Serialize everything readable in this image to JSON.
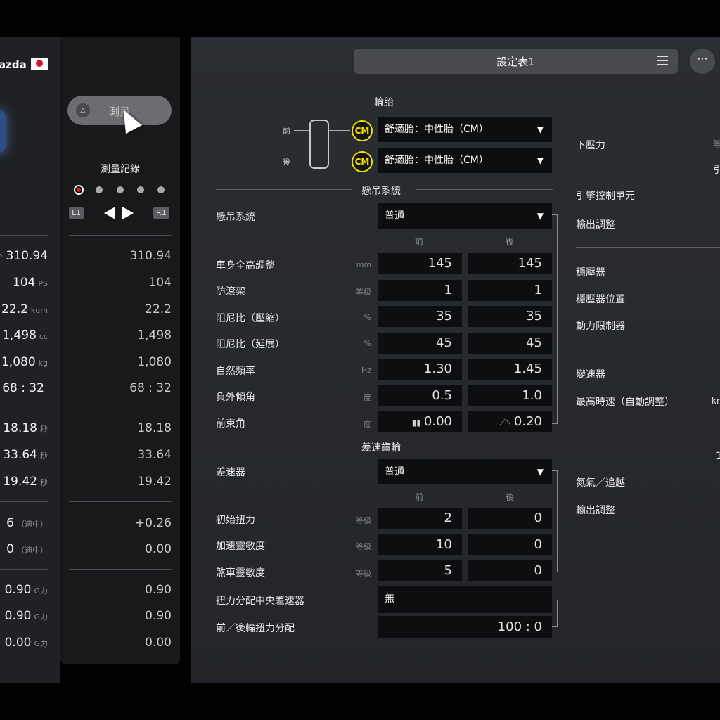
{
  "left_panel": {
    "car_name": "azda",
    "rows": [
      {
        "value": "310.94",
        "unit": "",
        "prefix": "P"
      },
      {
        "value": "104",
        "unit": "PS"
      },
      {
        "value": "22.2",
        "unit": "kgm"
      },
      {
        "value": "1,498",
        "unit": "cc"
      },
      {
        "value": "1,080",
        "unit": "kg"
      },
      {
        "value": "68 : 32",
        "unit": ""
      },
      {
        "value": "18.18",
        "unit": "秒"
      },
      {
        "value": "33.64",
        "unit": "秒"
      },
      {
        "value": "19.42",
        "unit": "秒"
      },
      {
        "value": "6",
        "unit": "（適中）"
      },
      {
        "value": "0",
        "unit": "（適中）"
      },
      {
        "value": "0.90",
        "unit": "G力"
      },
      {
        "value": "0.90",
        "unit": "G力"
      },
      {
        "value": "0.00",
        "unit": "G力"
      }
    ]
  },
  "compare_panel": {
    "measure_label": "測量",
    "measure_icon": "triangle-icon",
    "log_title": "測量紀錄",
    "l1": "L1",
    "r1": "R1",
    "rows": [
      "310.94",
      "104",
      "22.2",
      "1,498",
      "1,080",
      "68 : 32",
      "18.18",
      "33.64",
      "19.42",
      "+0.26",
      "0.00",
      "0.90",
      "0.90",
      "0.00"
    ]
  },
  "header": {
    "sheet_title": "設定表1",
    "more_label": "···"
  },
  "tires": {
    "title": "輪胎",
    "front_label": "前",
    "rear_label": "後",
    "badge": "CM",
    "front_value": "舒適胎：中性胎（CM）",
    "rear_value": "舒適胎：中性胎（CM）"
  },
  "suspension": {
    "title": "懸吊系統",
    "type_label": "懸吊系統",
    "type_value": "普通",
    "front_header": "前",
    "rear_header": "後",
    "rows": [
      {
        "label": "車身全高調整",
        "unit": "mm",
        "front": "145",
        "rear": "145"
      },
      {
        "label": "防滾架",
        "unit": "等級",
        "front": "1",
        "rear": "1"
      },
      {
        "label": "阻尼比（壓縮）",
        "unit": "%",
        "front": "35",
        "rear": "35"
      },
      {
        "label": "阻尼比（延展）",
        "unit": "%",
        "front": "45",
        "rear": "45"
      },
      {
        "label": "自然頻率",
        "unit": "Hz",
        "front": "1.30",
        "rear": "1.45"
      },
      {
        "label": "負外傾角",
        "unit": "度",
        "front": "0.5",
        "rear": "1.0"
      },
      {
        "label": "前束角",
        "unit": "度",
        "front": "0.00",
        "rear": "0.20"
      }
    ]
  },
  "differential": {
    "title": "差速齒輪",
    "type_label": "差速器",
    "type_value": "普通",
    "front_header": "前",
    "rear_header": "後",
    "rows": [
      {
        "label": "初始扭力",
        "unit": "等級",
        "front": "2",
        "rear": "0"
      },
      {
        "label": "加速靈敏度",
        "unit": "等級",
        "front": "10",
        "rear": "0"
      },
      {
        "label": "煞車靈敏度",
        "unit": "等級",
        "front": "5",
        "rear": "0"
      }
    ],
    "center_label": "扭力分配中央差速器",
    "center_value": "無",
    "split_label": "前／後輪扭力分配",
    "split_value": "100 : 0"
  },
  "right_column": {
    "downforce": "下壓力",
    "downforce_partial": "等",
    "partial_2": "引",
    "ecu": "引擎控制單元",
    "output_adjust": "輸出調整",
    "ballast": "穩壓器",
    "ballast_position": "穩壓器位置",
    "power_limiter": "動力限制器",
    "transmission": "變速器",
    "top_speed": "最高時速（自動調整）",
    "top_speed_unit_partial": "km",
    "partial_3": "1",
    "nitrous": "氮氣／追越",
    "output_adjust_2": "輸出調整"
  }
}
